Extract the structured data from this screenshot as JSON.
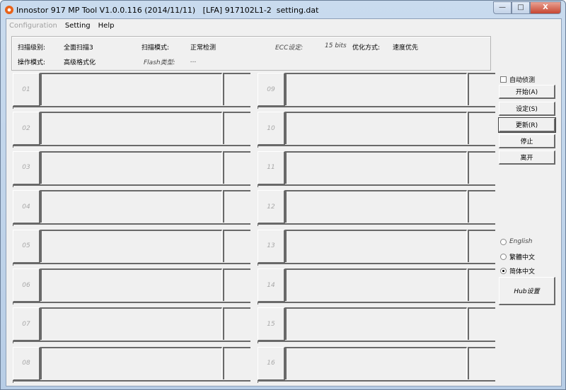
{
  "window": {
    "title": "Innostor 917 MP Tool V1.0.0.116 (2014/11/11)   [LFA] 917102L1-2  setting.dat",
    "minimize": "—",
    "maximize": "□",
    "close": "X"
  },
  "menu": [
    "Configuration",
    "Setting",
    "Help"
  ],
  "info": {
    "scan_level_label": "扫描级别:",
    "scan_level": "全面扫描3",
    "scan_mode_label": "扫描模式:",
    "scan_mode": "正常检测",
    "ecc_label": "ECC设定:",
    "ecc": "15 bits",
    "optimize_label": "优化方式:",
    "optimize": "速度优先",
    "op_mode_label": "操作模式:",
    "op_mode": "高级格式化",
    "flash_label": "Flash类型:",
    "flash": "..."
  },
  "ports": [
    "01",
    "02",
    "03",
    "04",
    "05",
    "06",
    "07",
    "08",
    "09",
    "10",
    "11",
    "12",
    "13",
    "14",
    "15",
    "16"
  ],
  "controls": {
    "auto_detect": "自动侦测",
    "start": "开始(A)",
    "settings": "设定(S)",
    "refresh": "更新(R)",
    "stop": "停止",
    "exit": "离开",
    "hub": "Hub设置"
  },
  "languages": [
    {
      "label": "English",
      "selected": false
    },
    {
      "label": "繁體中文",
      "selected": false
    },
    {
      "label": "简体中文",
      "selected": true
    }
  ]
}
